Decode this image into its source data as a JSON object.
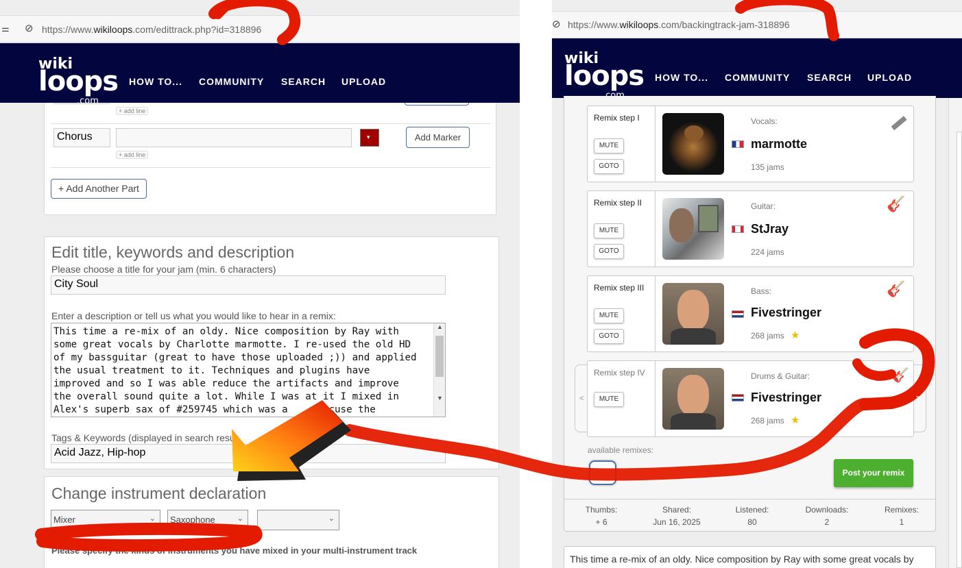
{
  "left": {
    "address": {
      "prefix": "https://www.",
      "domain": "wikiloops",
      "rest": ".com/edittrack.php?id=318896"
    },
    "logo": {
      "top": "wiki",
      "main": "loops",
      "suffix": ".com"
    },
    "nav": [
      "HOW TO...",
      "COMMUNITY",
      "SEARCH",
      "UPLOAD"
    ],
    "parts": {
      "add_line": "+ add line",
      "chorus_value": "Chorus",
      "add_marker": "Add Marker",
      "add_part": "+ Add Another Part"
    },
    "edit": {
      "heading": "Edit title, keywords and description",
      "title_label": "Please choose a title for your jam (min. 6 characters)",
      "title_value": "City Soul",
      "desc_label": "Enter a description or tell us what you would like to hear in a remix:",
      "desc_value": "This time a re-mix of an oldy. Nice composition by Ray with\nsome great vocals by Charlotte marmotte. I re-used the old HD\nof my bassguitar (great to have those uploaded ;)) and applied\nthe usual treatment to it. Techniques and plugins have\nimproved and so I was able reduce the artifacts and improve\nthe overall sound quite a lot. While I was at it I mixed in\nAlex's superb sax of #259745 which was a     excuse the",
      "tags_label": "Tags & Keywords (displayed in search resu",
      "tags_value": "Acid Jazz, Hip-hop"
    },
    "instrument": {
      "heading": "Change instrument declaration",
      "selects": [
        "Mixer",
        "Saxophone",
        ""
      ],
      "note": "Please specify the kinds of instruments you have mixed in your multi-instrument track"
    }
  },
  "right": {
    "address": {
      "prefix": "https://www.",
      "domain": "wikiloops",
      "rest": ".com/backingtrack-jam-318896"
    },
    "steps": [
      {
        "label": "Remix step I",
        "role": "Vocals:",
        "user": "marmotte",
        "jams": "135 jams",
        "mute": "MUTE",
        "goto": "GOTO"
      },
      {
        "label": "Remix step II",
        "role": "Guitar:",
        "user": "StJray",
        "jams": "224 jams",
        "mute": "MUTE",
        "goto": "GOTO"
      },
      {
        "label": "Remix step III",
        "role": "Bass:",
        "user": "Fivestringer",
        "jams": "268 jams",
        "mute": "MUTE",
        "goto": "GOTO"
      },
      {
        "label": "Remix step IV",
        "role": "Drums & Guitar:",
        "user": "Fivestringer",
        "jams": "268 jams",
        "mute": "MUTE"
      }
    ],
    "prev": "<",
    "next": ">",
    "available": "available remixes:",
    "post": "Post your remix",
    "stats": [
      {
        "label": "Thumbs:",
        "value": "+ 6"
      },
      {
        "label": "Shared:",
        "value": "Jun 16, 2025"
      },
      {
        "label": "Listened:",
        "value": "80"
      },
      {
        "label": "Downloads:",
        "value": "2"
      },
      {
        "label": "Remixes:",
        "value": "1"
      }
    ],
    "desc": "This time a re-mix of an oldy. Nice composition by Ray with some great vocals by"
  },
  "colors": {
    "navbar": "#02053e",
    "post_button": "#4caf2f",
    "annotation_red": "#e31b00",
    "marker_swatch": "#a00000"
  }
}
